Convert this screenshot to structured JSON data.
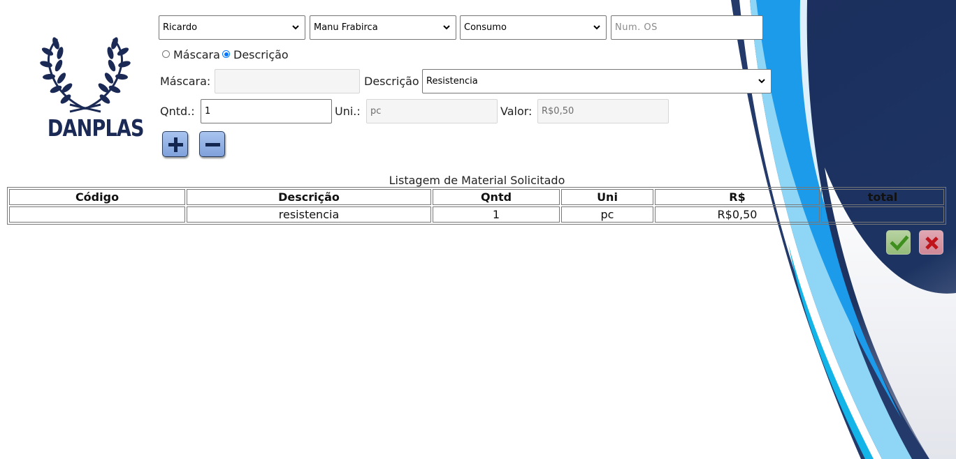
{
  "logo": {
    "text": "DANPLAS"
  },
  "filters": {
    "requester": {
      "value": "Ricardo"
    },
    "sector": {
      "value": "Manu Frabirca"
    },
    "type": {
      "value": "Consumo"
    },
    "os_number": {
      "placeholder": "Num. OS",
      "value": ""
    }
  },
  "search_mode": {
    "options": [
      {
        "label": "Máscara",
        "checked": false
      },
      {
        "label": "Descrição",
        "checked": true
      }
    ]
  },
  "form": {
    "mask_label": "Máscara:",
    "mask_value": "",
    "description_label": "Descrição",
    "description_value": "Resistencia",
    "qty_label": "Qntd.:",
    "qty_value": "1",
    "unit_label": "Uni.:",
    "unit_value": "pc",
    "price_label": "Valor:",
    "price_value": "R$0,50"
  },
  "buttons": {
    "add_icon": "plus-icon",
    "remove_icon": "minus-icon",
    "confirm_icon": "check-icon",
    "cancel_icon": "x-icon"
  },
  "table": {
    "caption": "Listagem de Material Solicitado",
    "columns": [
      "Código",
      "Descrição",
      "Qntd",
      "Uni",
      "R$",
      "total"
    ],
    "rows": [
      [
        "",
        "resistencia",
        "1",
        "pc",
        "R$0,50",
        ""
      ]
    ]
  },
  "colors": {
    "navy": "#1b2a55",
    "bright_blue": "#1c9bea",
    "light_blue": "#8fd5f5",
    "radio_blue": "#0075ff"
  }
}
